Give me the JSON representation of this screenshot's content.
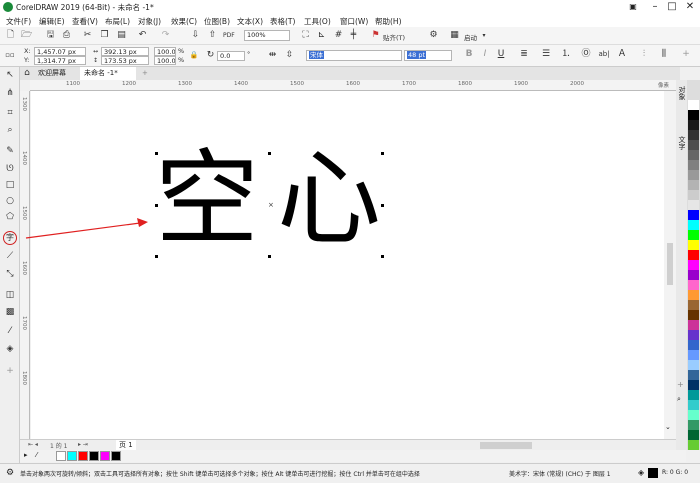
{
  "titlebar": {
    "title": "CorelDRAW 2019 (64-Bit) - 未命名 -1*",
    "minimize": "–",
    "maximize": "□",
    "close": "✕"
  },
  "menu": [
    "文件(F)",
    "编辑(E)",
    "查看(V)",
    "布局(L)",
    "对象(J)",
    "效果(C)",
    "位图(B)",
    "文本(X)",
    "表格(T)",
    "工具(O)",
    "窗口(W)",
    "帮助(H)"
  ],
  "toolbar1": {
    "zoom": "100%",
    "snap": "贴齐(T)",
    "launch": "启动"
  },
  "toolbar2": {
    "x": "1,457.07 px",
    "y": "1,314.77 px",
    "w": "392.13 px",
    "h": "173.53 px",
    "sx": "100.0",
    "sy": "100.0",
    "pct": "%",
    "angle": "0.0",
    "font": "宋体",
    "size": "48 pt",
    "x_label": "X:",
    "y_label": "Y:"
  },
  "tabs": {
    "welcome": "欢迎屏幕",
    "doc": "未命名 -1*",
    "add": "+"
  },
  "ruler_h": [
    "1100",
    "1200",
    "1300",
    "1400",
    "1500",
    "1600",
    "1700",
    "1800",
    "1900",
    "2000"
  ],
  "ruler_unit": "像素",
  "ruler_v": [
    "1300",
    "1400",
    "1500",
    "1600",
    "1700",
    "1800"
  ],
  "canvas": {
    "char1": "空",
    "char2": "心"
  },
  "page": {
    "label": "页 1",
    "counter": "1 的 1"
  },
  "dockers": [
    "对象",
    "文字"
  ],
  "status": {
    "hint": "单击对象两次可旋转/倾斜；双击工具可选择所有对象；按住 Shift 键单击可选择多个对象；按住 Alt 键单击可进行挖掘；按住 Ctrl 并单击可在组中选择",
    "style": "美术字：宋体 (常规) (CHC) 于 图层 1",
    "rgb": "R: 0 G: 0"
  },
  "colors": {
    "palette": [
      "#ffffff",
      "#000000",
      "#1a1a1a",
      "#333333",
      "#4d4d4d",
      "#666666",
      "#808080",
      "#999999",
      "#b3b3b3",
      "#cccccc",
      "#e6e6e6",
      "#0000ff",
      "#00ffff",
      "#00ff00",
      "#ffff00",
      "#ff0000",
      "#ff00ff",
      "#9900cc",
      "#ff66cc",
      "#ff9933",
      "#996633",
      "#663300",
      "#cc3399",
      "#6633cc",
      "#3366cc",
      "#6699ff",
      "#99ccff",
      "#336699",
      "#003366",
      "#009999",
      "#33cccc",
      "#66ffcc",
      "#339966",
      "#006633",
      "#66cc33"
    ],
    "doc_palette": [
      "#ffffff",
      "#00ffff",
      "#ff0000",
      "#000000",
      "#ff00ff",
      "#000000"
    ],
    "annotation": "#e02020"
  }
}
